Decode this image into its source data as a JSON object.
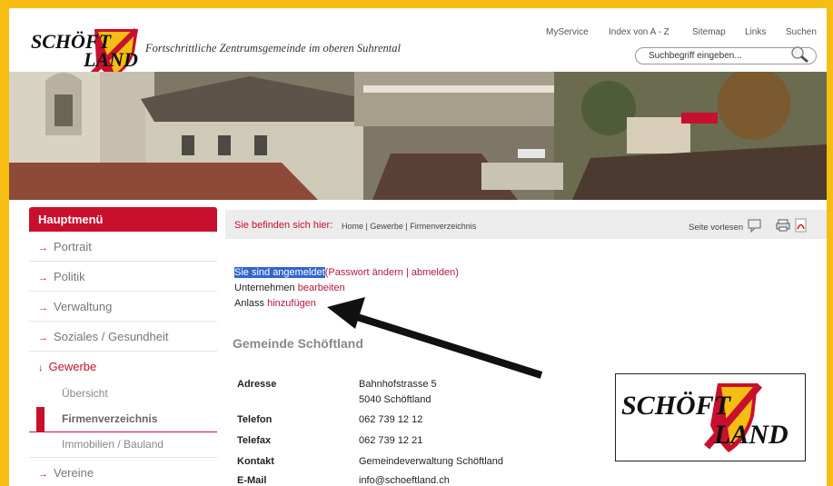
{
  "header": {
    "logo_text_top": "SCHÖFT",
    "logo_text_bottom": "LAND",
    "slogan": "Fortschrittliche Zentrumsgemeinde im oberen Suhrental",
    "topnav": [
      "MyService",
      "Index von A - Z",
      "Sitemap",
      "Links",
      "Suchen"
    ],
    "search_placeholder": "Suchbegriff eingeben..."
  },
  "sidebar": {
    "title": "Hauptmenü",
    "items": [
      {
        "label": "Portrait",
        "arrow": "→"
      },
      {
        "label": "Politik",
        "arrow": "→"
      },
      {
        "label": "Verwaltung",
        "arrow": "→"
      },
      {
        "label": "Soziales / Gesundheit",
        "arrow": "→"
      },
      {
        "label": "Gewerbe",
        "arrow": "↓"
      },
      {
        "label": "Vereine",
        "arrow": "→"
      }
    ],
    "subitems": [
      "Übersicht",
      "Firmenverzeichnis",
      "Immobilien / Bauland"
    ]
  },
  "breadcrumb": {
    "label": "Sie befinden sich hier:",
    "path": "Home | Gewerbe | Firmenverzeichnis",
    "read_aloud": "Seite vorlesen"
  },
  "status": {
    "logged_in": "Sie sind angemeldet",
    "open_paren": "(",
    "change_password": "Passwort ändern",
    "sep": " | ",
    "logout": "abmelden",
    "close_paren": ")",
    "company_label": "Unternehmen",
    "company_edit": "bearbeiten",
    "event_label": "Anlass",
    "event_add": "hinzufügen"
  },
  "content": {
    "heading": "Gemeinde Schöftland",
    "rows": [
      {
        "label": "Adresse",
        "value": "Bahnhofstrasse 5",
        "value2": "5040 Schöftland"
      },
      {
        "label": "Telefon",
        "value": "062 739 12 12"
      },
      {
        "label": "Telefax",
        "value": "062 739 12 21"
      },
      {
        "label": "Kontakt",
        "value": "Gemeindeverwaltung Schöftland"
      },
      {
        "label": "E-Mail",
        "value": "info@schoeftland.ch"
      }
    ]
  },
  "colors": {
    "frame": "#f6bd12",
    "accent": "#c8102e",
    "link": "#b11b3a",
    "selection": "#3366cc"
  }
}
